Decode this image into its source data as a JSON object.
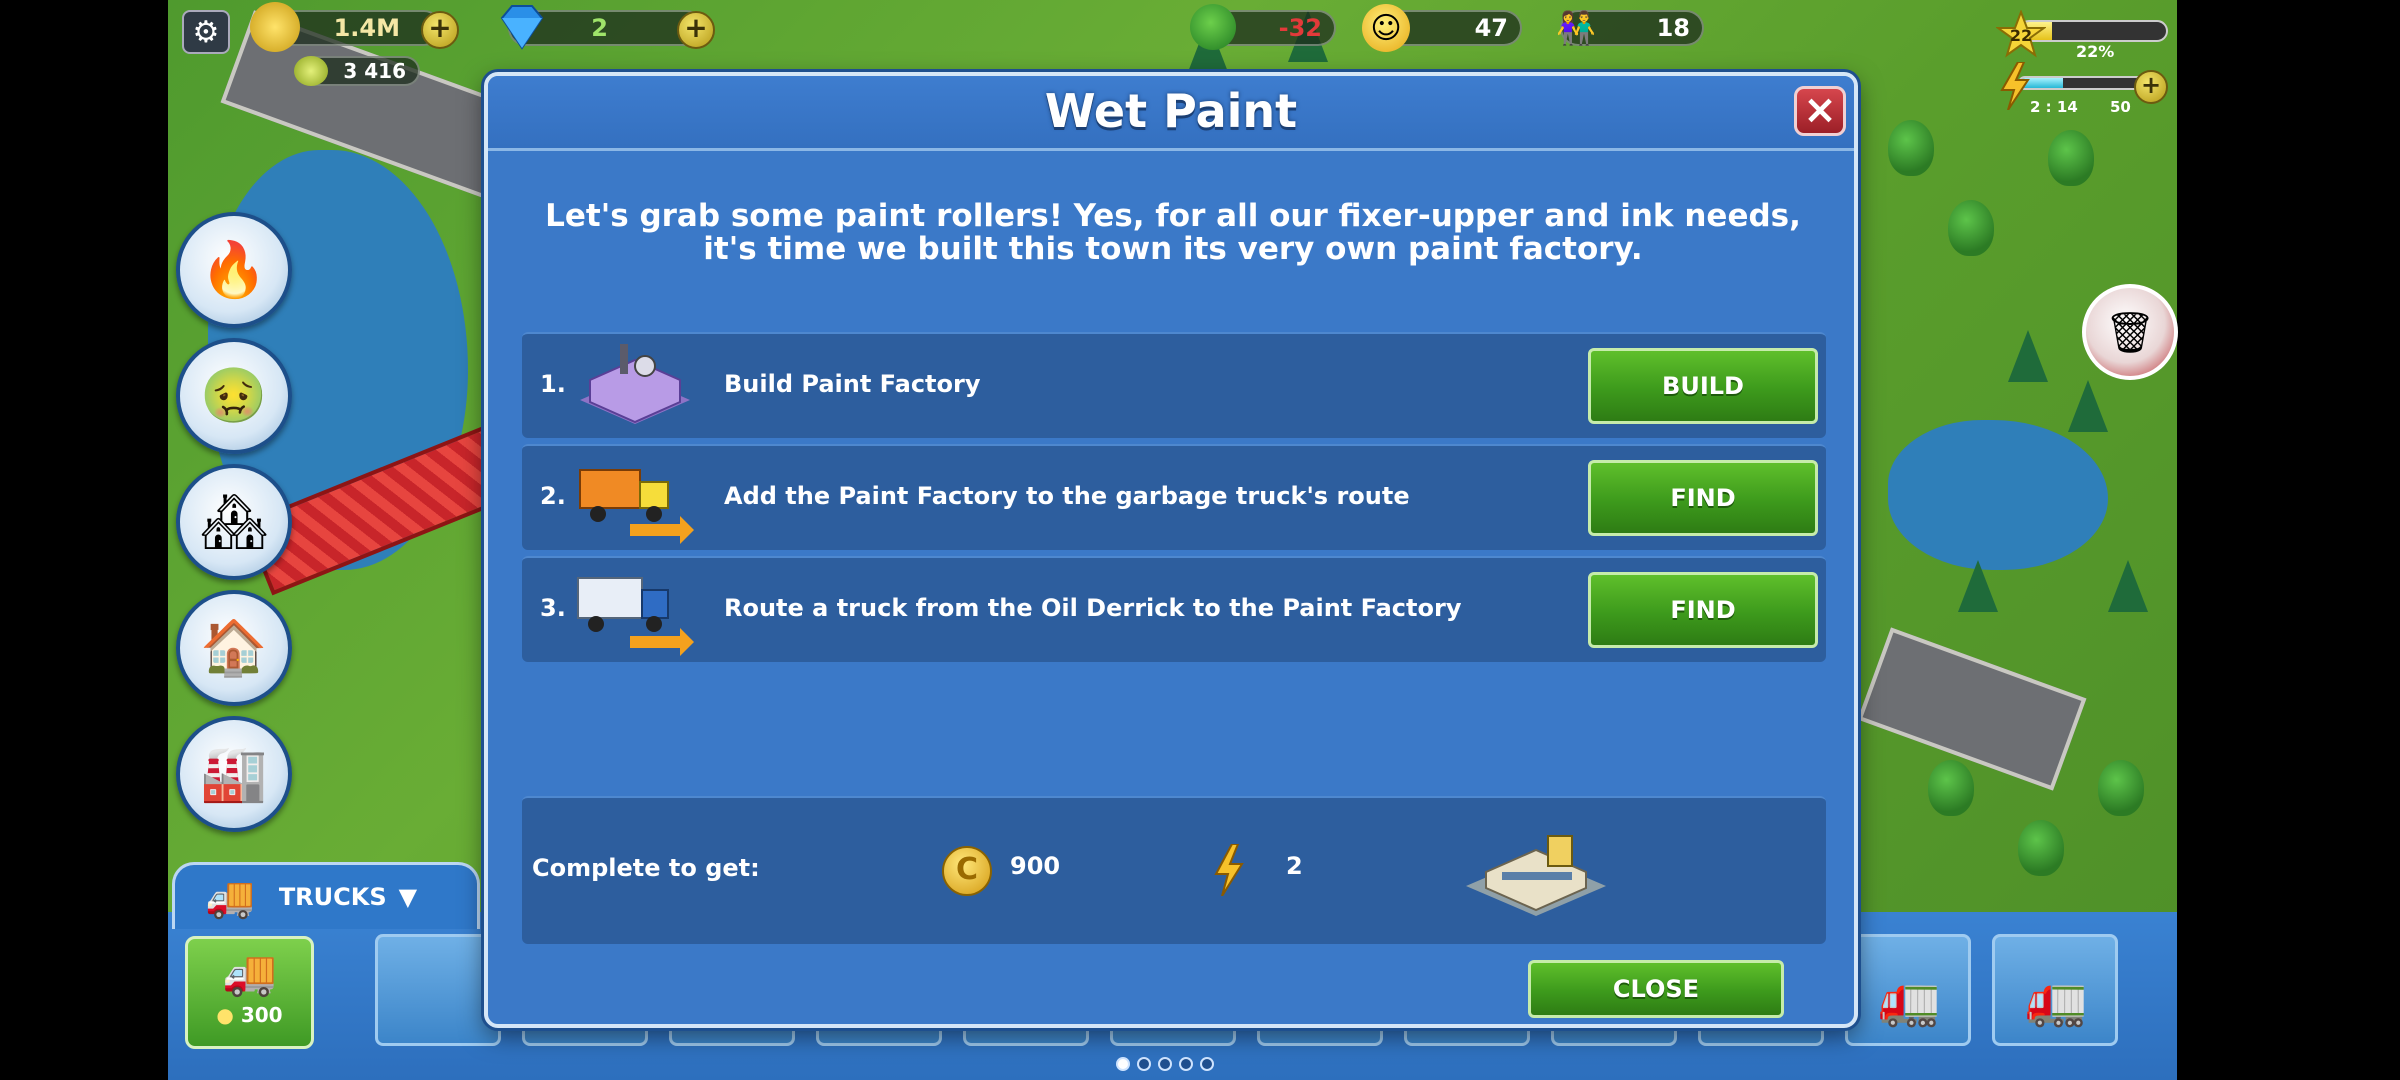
{
  "hud": {
    "coins": "1.4M",
    "cash": "3 416",
    "diamonds": "2",
    "environment": "-32",
    "happiness": "47",
    "population": "18",
    "level": "22",
    "xp_percent": "22%",
    "xp_fraction": 0.22,
    "energy_timer": "2 : 14",
    "energy_max": "50",
    "energy_fraction": 0.35
  },
  "side_buttons": [
    {
      "icon": "fire-station-icon"
    },
    {
      "icon": "sick-thermometer-icon"
    },
    {
      "icon": "buildings-icon"
    },
    {
      "icon": "upgrade-house-icon"
    },
    {
      "icon": "paint-factory-icon"
    }
  ],
  "modal": {
    "title": "Wet Paint",
    "close_icon": "×",
    "intro": "Let's grab some paint rollers! Yes, for all our fixer-upper and ink needs, it's time we built this town its very own paint factory.",
    "tasks": [
      {
        "num": "1.",
        "text": "Build Paint Factory",
        "button": "BUILD",
        "icon": "paint-factory-icon"
      },
      {
        "num": "2.",
        "text": "Add the Paint Factory to the garbage truck's route",
        "button": "FIND",
        "icon": "garbage-truck-route-icon"
      },
      {
        "num": "3.",
        "text": "Route a truck from the Oil Derrick to the Paint Factory",
        "button": "FIND",
        "icon": "truck-route-icon"
      }
    ],
    "reward_label": "Complete to get:",
    "reward_coins": "900",
    "reward_energy": "2",
    "close_button": "CLOSE"
  },
  "bottom": {
    "trucks_tab": "TRUCKS",
    "add_truck_price": "300",
    "page_count": 5,
    "active_page": 0
  },
  "colors": {
    "modal_bg": "#3b79c8",
    "row_bg": "#2d5e9e",
    "green_button": "#3d9a1c",
    "close_red": "#9c1f27"
  }
}
